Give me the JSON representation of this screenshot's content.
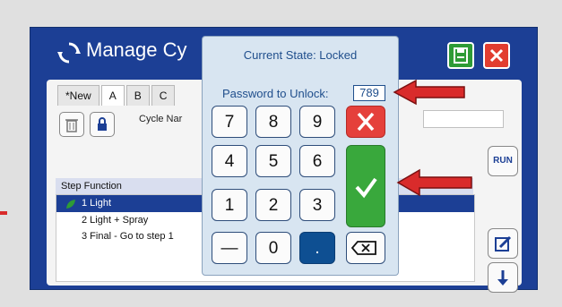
{
  "window": {
    "title": "Manage Cy",
    "colors": {
      "frame": "#1c3f95",
      "save": "#2e9b36",
      "close": "#e23d2f"
    }
  },
  "tabs": [
    "*New",
    "A",
    "B",
    "C"
  ],
  "cycle_name_label": "Cycle Nar",
  "run_label": "RUN",
  "list": {
    "header": "Step Function",
    "items": [
      "1 Light",
      "2 Light + Spray",
      "3 Final - Go to step 1"
    ]
  },
  "keypad": {
    "state": "Current State: Locked",
    "password_label": "Password to Unlock:",
    "password_value": "789",
    "keys": [
      [
        "7",
        "8",
        "9"
      ],
      [
        "4",
        "5",
        "6"
      ],
      [
        "1",
        "2",
        "3"
      ],
      [
        "—",
        "0",
        "."
      ]
    ],
    "icons": {
      "cancel": "x-icon",
      "confirm": "check-icon",
      "backspace": "backspace-icon"
    }
  }
}
